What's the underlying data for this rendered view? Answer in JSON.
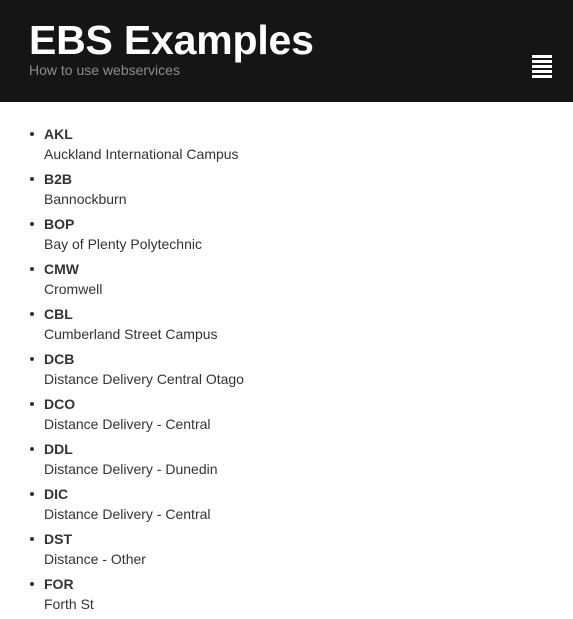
{
  "header": {
    "title": "EBS Examples",
    "subtitle": "How to use webservices",
    "menu_icon": "hamburger-menu-icon",
    "background": "#151515"
  },
  "campuses": [
    {
      "code": "AKL",
      "name": "Auckland International Campus"
    },
    {
      "code": "B2B",
      "name": "Bannockburn"
    },
    {
      "code": "BOP",
      "name": "Bay of Plenty Polytechnic"
    },
    {
      "code": "CMW",
      "name": "Cromwell"
    },
    {
      "code": "CBL",
      "name": "Cumberland Street Campus"
    },
    {
      "code": "DCB",
      "name": "Distance Delivery Central Otago"
    },
    {
      "code": "DCO",
      "name": "Distance Delivery - Central"
    },
    {
      "code": "DDL",
      "name": "Distance Delivery - Dunedin"
    },
    {
      "code": "DIC",
      "name": "Distance Delivery - Central"
    },
    {
      "code": "DST",
      "name": "Distance - Other"
    },
    {
      "code": "FOR",
      "name": "Forth St"
    }
  ]
}
